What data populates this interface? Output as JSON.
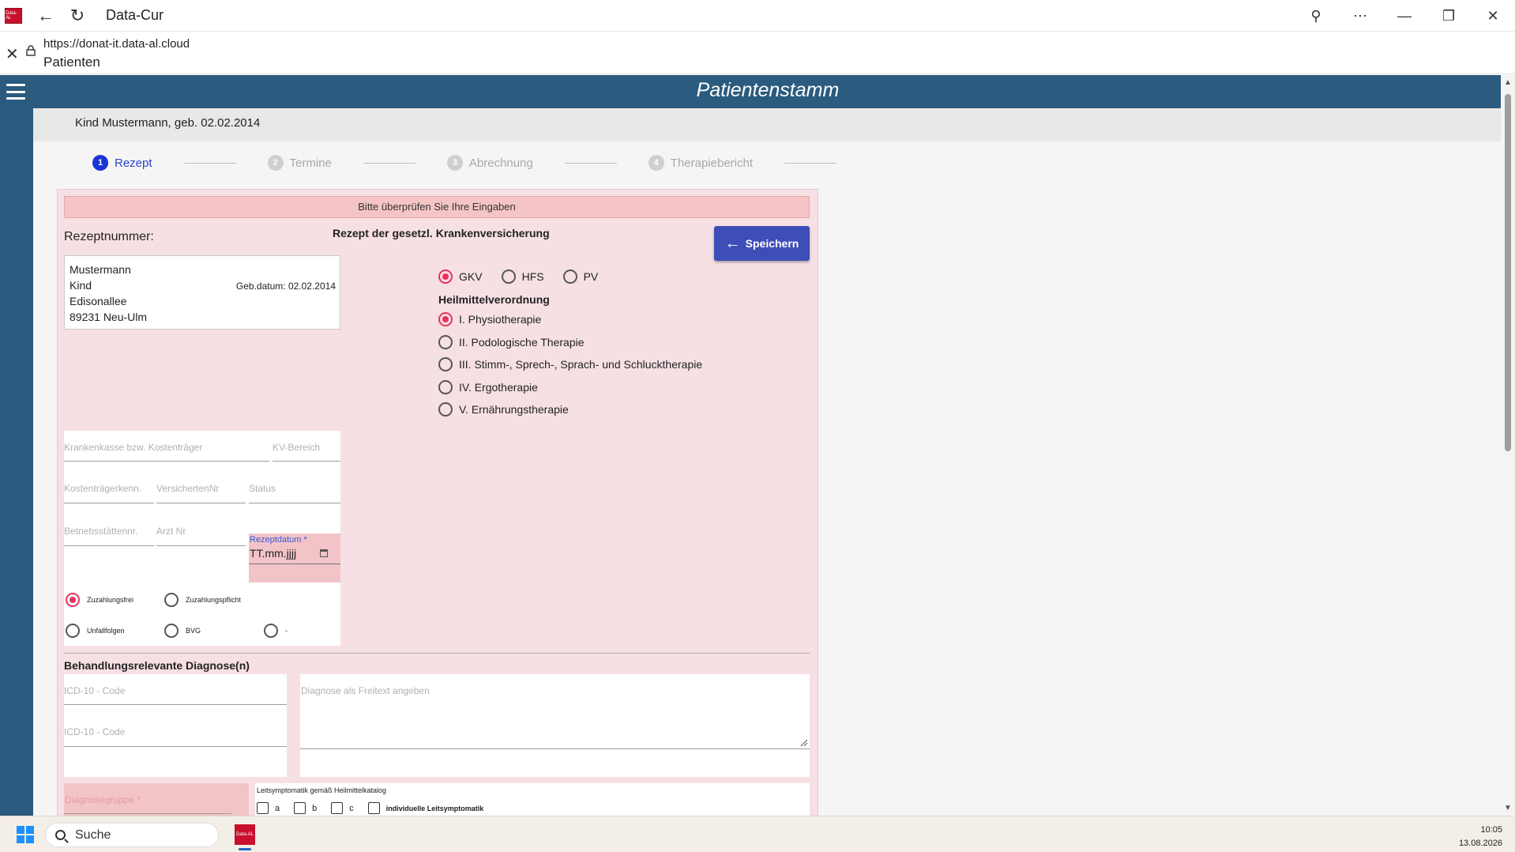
{
  "window": {
    "title": "Data-Cur",
    "logo_text": "Data-AL"
  },
  "address": {
    "url": "https://donat-it.data-al.cloud",
    "page_name": "Patienten"
  },
  "app": {
    "title": "Patientenstamm",
    "patient_line": "Kind Mustermann, geb. 02.02.2014"
  },
  "stepper": [
    {
      "num": "1",
      "label": "Rezept"
    },
    {
      "num": "2",
      "label": "Termine"
    },
    {
      "num": "3",
      "label": "Abrechnung"
    },
    {
      "num": "4",
      "label": "Therapiebericht"
    }
  ],
  "form": {
    "alert": "Bitte überprüfen Sie Ihre Eingaben",
    "rx_number_label": "Rezeptnummer:",
    "rx_heading": "Rezept der gesetzl. Krankenversicherung",
    "save_label": "Speichern",
    "patient": {
      "lastname": "Mustermann",
      "firstname": "Kind",
      "street": "Edisonallee",
      "city": "89231 Neu-Ulm",
      "birth": "Geb.datum: 02.02.2014"
    },
    "insurer_options": [
      "GKV",
      "HFS",
      "PV"
    ],
    "insurer_selected": "GKV",
    "heilmittel_title": "Heilmittelverordnung",
    "heilmittel_options": [
      "I. Physiotherapie",
      "II. Podologische Therapie",
      "III. Stimm-, Sprech-, Sprach- und Schlucktherapie",
      "IV. Ergotherapie",
      "V. Ernährungstherapie"
    ],
    "heilmittel_selected": "I. Physiotherapie",
    "fields": {
      "krankenkasse": "Krankenkasse bzw. Kostenträger",
      "kv_bereich": "KV-Bereich",
      "kostentraeger": "Kostenträgerkenn.",
      "versichertennr": "VersichertenNr",
      "status": "Status",
      "betriebsstaette": "Betriebsstättennr.",
      "arzt_nr": "Arzt Nr",
      "rezeptdatum_label": "Rezeptdatum *",
      "rezeptdatum_value": "TT.mm.jjjj"
    },
    "zuzahlung": {
      "frei": "Zuzahlungsfrei",
      "pflicht": "Zuzahlungspflicht",
      "unfall": "Unfallfolgen",
      "bvg": "BVG",
      "none": "-"
    },
    "diagnose_title": "Behandlungsrelevante Diagnose(n)",
    "icd1": "ICD-10 - Code",
    "icd2": "ICD-10 - Code",
    "freitext": "Diagnose als Freitext angeben",
    "diagnosegruppe": "Diagnosegruppe *",
    "leitsymptomatik_title": "Leitsymptomatik gemäß Heilmittelkatalog",
    "leitsymptomatik": [
      "a",
      "b",
      "c",
      "individuelle Leitsymptomatik"
    ]
  },
  "taskbar": {
    "search": "Suche",
    "time": "10:05",
    "date": "13.08.2026"
  },
  "colors": {
    "header": "#2b5b7e",
    "accent_radio": "#e8335f",
    "save_button": "#3f4db8",
    "step_active": "#1a35d6"
  }
}
